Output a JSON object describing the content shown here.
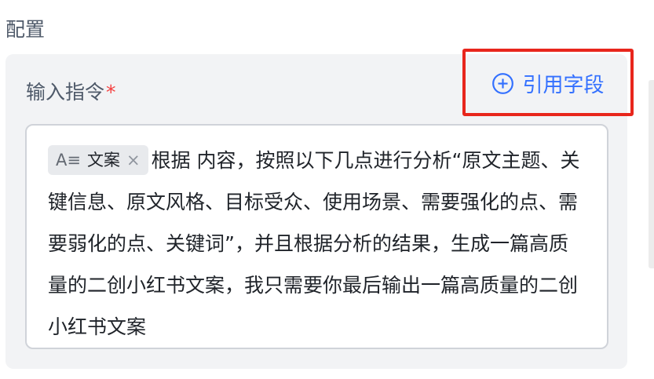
{
  "section": {
    "title": "配置"
  },
  "instruction": {
    "label": "输入指令",
    "required_mark": "*",
    "reference_button_label": "引用字段",
    "reference_button_icon": "plus-circle-icon",
    "tag": {
      "icon_text": "A≡",
      "label": "文案",
      "close": "×"
    },
    "text": "根据 内容，按照以下几点进行分析“原文主题、关键信息、原文风格、目标受众、使用场景、需要强化的点、需要弱化的点、关键词”，并且根据分析的结果，生成一篇高质量的二创小红书文案，我只需要你最后输出一篇高质量的二创小红书文案"
  },
  "colors": {
    "accent": "#3370ff",
    "required": "#f53f3f",
    "highlight_border": "#e8261c",
    "card_bg": "#f2f3f5"
  }
}
